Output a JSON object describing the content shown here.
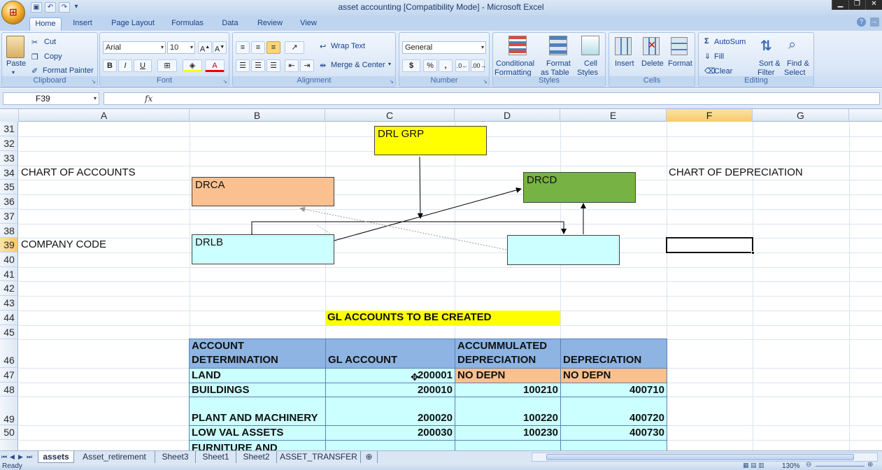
{
  "window": {
    "title": "asset accounting  [Compatibility Mode] - Microsoft Excel",
    "office_button_glyph": "⊞"
  },
  "tabs": [
    "Home",
    "Insert",
    "Page Layout",
    "Formulas",
    "Data",
    "Review",
    "View"
  ],
  "active_tab": "Home",
  "ribbon": {
    "clipboard": {
      "label": "Clipboard",
      "paste": "Paste",
      "cut": "Cut",
      "copy": "Copy",
      "format_painter": "Format Painter"
    },
    "font": {
      "label": "Font",
      "name": "Arial",
      "size": "10",
      "bold": "B",
      "italic": "I",
      "underline": "U"
    },
    "alignment": {
      "label": "Alignment",
      "wrap_text": "Wrap Text",
      "merge_center": "Merge & Center"
    },
    "number": {
      "label": "Number",
      "format": "General",
      "currency": "$",
      "percent": "%",
      "comma": ","
    },
    "styles": {
      "label": "Styles",
      "conditional": "Conditional",
      "formatting": "Formatting",
      "format": "Format",
      "as_table": "as Table",
      "cell": "Cell",
      "cell_styles": "Styles"
    },
    "cells": {
      "label": "Cells",
      "insert": "Insert",
      "delete": "Delete",
      "format": "Format"
    },
    "editing": {
      "label": "Editing",
      "autosum": "AutoSum",
      "fill": "Fill",
      "clear": "Clear",
      "sort": "Sort &",
      "filter": "Filter",
      "find": "Find &",
      "select": "Select"
    }
  },
  "formula_bar": {
    "name_box": "F39",
    "fx": "fx",
    "content": ""
  },
  "columns": [
    "A",
    "B",
    "C",
    "D",
    "E",
    "F",
    "G"
  ],
  "selected_column": "F",
  "rows": [
    "31",
    "32",
    "33",
    "34",
    "35",
    "36",
    "37",
    "38",
    "39",
    "40",
    "41",
    "42",
    "43",
    "44",
    "45",
    "46",
    "47",
    "48",
    "49",
    "50",
    ""
  ],
  "selected_row": "39",
  "cells": {
    "chart_of_accounts": "CHART OF ACCOUNTS",
    "company_code": "COMPANY CODE",
    "chart_of_depreciation": "CHART OF DEPRECIATION",
    "gl_title": "GL ACCOUNTS TO BE CREATED"
  },
  "shapes": {
    "drl_grp": "DRL GRP",
    "drca": "DRCA",
    "drcd": "DRCD",
    "drlb": "DRLB",
    "unlabeled": ""
  },
  "shape_colors": {
    "drl_grp": "#ffff00",
    "drca": "#fac090",
    "drcd": "#77b244",
    "drlb": "#ccffff",
    "unlabeled": "#ccffff"
  },
  "gl_table": {
    "headers": [
      [
        "ACCOUNT",
        "DETERMINATION"
      ],
      [
        "",
        "GL ACCOUNT"
      ],
      [
        "ACCUMMULATED",
        "DEPRECIATION"
      ],
      [
        "",
        "DEPRECIATION"
      ]
    ],
    "rows": [
      [
        "LAND",
        "200001",
        "NO DEPN",
        "NO DEPN"
      ],
      [
        "BUILDINGS",
        "200010",
        "100210",
        "400710"
      ],
      [
        "PLANT AND MACHINERY",
        "200020",
        "100220",
        "400720"
      ],
      [
        "LOW VAL ASSETS",
        "200030",
        "100230",
        "400730"
      ],
      [
        "FURNITURE AND",
        "",
        "",
        ""
      ]
    ]
  },
  "sheet_tabs": [
    "assets",
    "Asset_retirement",
    "Sheet3",
    "Sheet1",
    "Sheet2",
    "ASSET_TRANSFER"
  ],
  "active_sheet": "assets",
  "status": {
    "text": "Ready",
    "zoom": "130%"
  },
  "colors": {
    "header_blue": "#8db4e2",
    "body_cyan": "#ccffff",
    "orange": "#fac090",
    "yellow": "#ffff00"
  }
}
